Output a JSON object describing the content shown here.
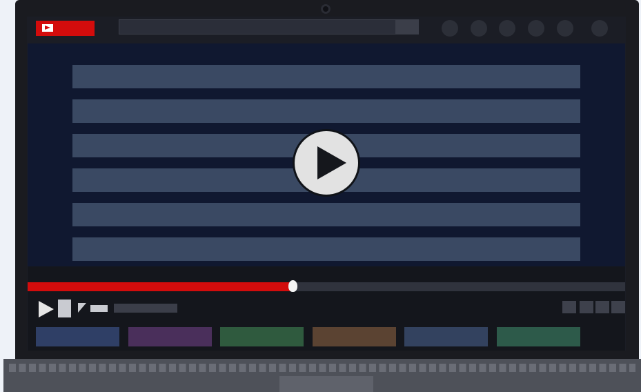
{
  "colors": {
    "accent_red": "#d30c0c",
    "bezel": "#1a1b20",
    "video_bg": "#101830",
    "video_lines": "#3a4963",
    "play_button": "#e2e2e2"
  },
  "header": {
    "logo_icon": "video-play-logo",
    "search": {
      "value": "",
      "placeholder": ""
    },
    "nav_icons": [
      "circle",
      "circle",
      "circle",
      "circle",
      "circle",
      "circle"
    ]
  },
  "player": {
    "state": "paused",
    "progress": 0.44,
    "overlay_icon": "play-icon",
    "time_label": ""
  },
  "controls": {
    "left_icons": [
      "play-icon",
      "stop-icon",
      "volume-icon"
    ],
    "right_icons": [
      "settings-icon",
      "quality-icon",
      "theater-icon",
      "fullscreen-icon"
    ]
  },
  "thumbnails": [
    {
      "color": "#2f3f66"
    },
    {
      "color": "#4a2f5b"
    },
    {
      "color": "#2f5a3e"
    },
    {
      "color": "#5b4332"
    },
    {
      "color": "#33425f"
    },
    {
      "color": "#2d5a4a"
    }
  ]
}
